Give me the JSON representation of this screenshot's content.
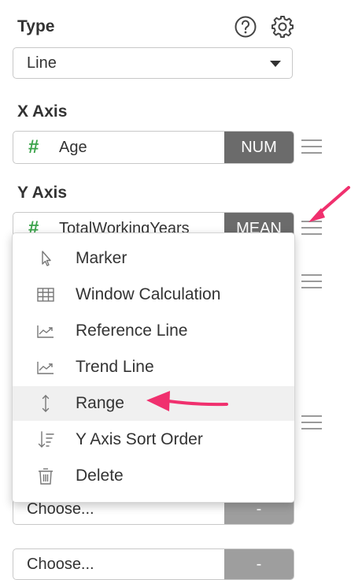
{
  "type_section": {
    "label": "Type",
    "help_icon": "question-circle-icon",
    "settings_icon": "gear-icon",
    "selected": "Line"
  },
  "x_axis": {
    "label": "X Axis",
    "field_name": "Age",
    "field_type_icon": "#",
    "aggregation": "NUM"
  },
  "y_axis": {
    "label": "Y Axis",
    "field_name": "TotalWorkingYears",
    "field_type_icon": "#",
    "aggregation": "MEAN"
  },
  "context_menu": {
    "items": [
      {
        "label": "Marker",
        "icon": "cursor-pointer-icon"
      },
      {
        "label": "Window Calculation",
        "icon": "table-grid-icon"
      },
      {
        "label": "Reference Line",
        "icon": "line-chart-icon"
      },
      {
        "label": "Trend Line",
        "icon": "line-chart-icon"
      },
      {
        "label": "Range",
        "icon": "vertical-range-arrows-icon",
        "highlighted": true
      },
      {
        "label": "Y Axis Sort Order",
        "icon": "sort-descending-icon"
      },
      {
        "label": "Delete",
        "icon": "trash-icon"
      }
    ]
  },
  "lower_selectors": [
    {
      "placeholder": "Choose...",
      "button": "-"
    },
    {
      "placeholder": "Choose...",
      "button": "-"
    }
  ],
  "colors": {
    "annotation_arrow": "#f0306e",
    "numeric_hash": "#3aa34a",
    "aggregation_bg": "#6b6b6b",
    "disabled_button_bg": "#9e9e9e"
  }
}
